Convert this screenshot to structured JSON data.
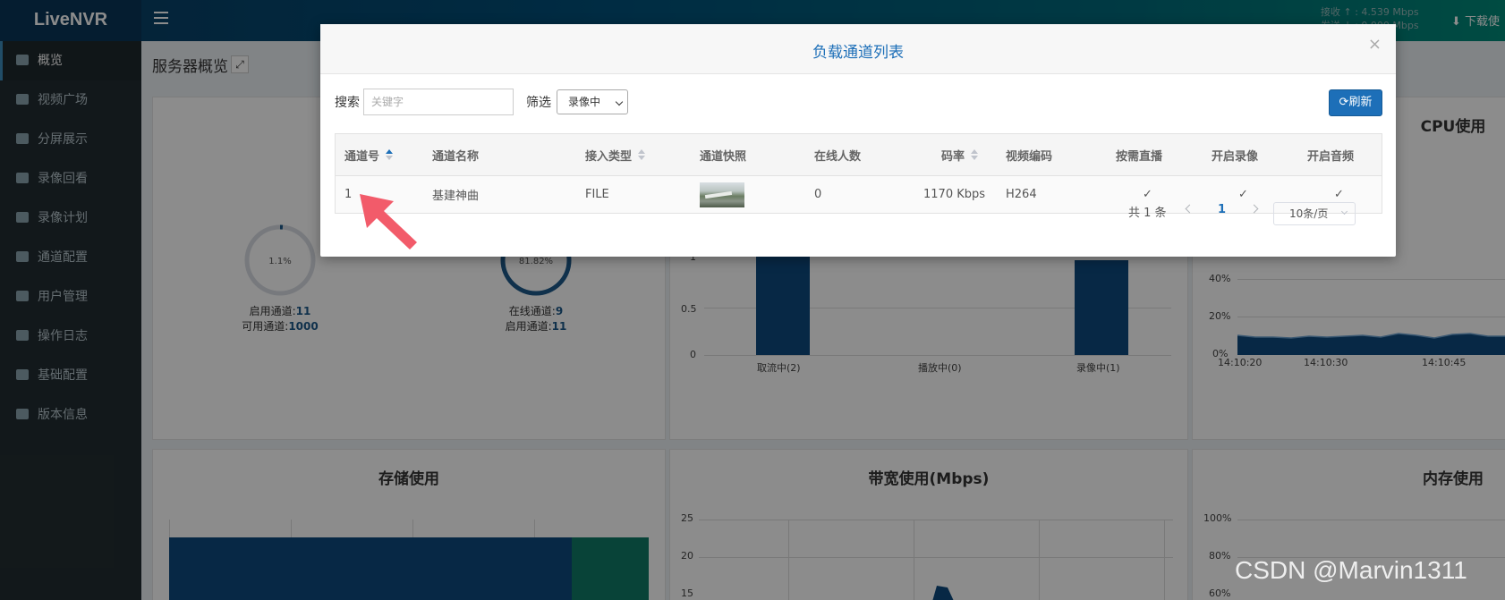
{
  "app": {
    "logo": "LiveNVR",
    "bandwidth_line1": "接收 ↑ : 4.539 Mbps",
    "bandwidth_line2": "发送 ↓ : 0.000 Mbps",
    "download_label": "下载使"
  },
  "sidebar": {
    "items": [
      {
        "label": "概览",
        "icon": "dashboard-icon"
      },
      {
        "label": "视频广场",
        "icon": "video-camera-icon"
      },
      {
        "label": "分屏展示",
        "icon": "grid-icon"
      },
      {
        "label": "录像回看",
        "icon": "backward-icon"
      },
      {
        "label": "录像计划",
        "icon": "calendar-icon"
      },
      {
        "label": "通道配置",
        "icon": "road-icon"
      },
      {
        "label": "用户管理",
        "icon": "users-icon"
      },
      {
        "label": "操作日志",
        "icon": "file-icon"
      },
      {
        "label": "基础配置",
        "icon": "gears-icon"
      },
      {
        "label": "版本信息",
        "icon": "info-icon"
      }
    ]
  },
  "overview": {
    "title": "服务器概览",
    "ring1_pct": "1.1%",
    "ring1_label1": "启用通道:",
    "ring1_value1": "11",
    "ring1_label2": "可用通道:",
    "ring1_value2": "1000",
    "ring2_pct": "81.82%",
    "ring2_label1": "在线通道:",
    "ring2_value1": "9",
    "ring2_label2": "启用通道:",
    "ring2_value2": "11",
    "cpu_title": "CPU使用",
    "storage_title": "存储使用",
    "bandwidth_title": "带宽使用(Mbps)",
    "memory_title": "内存使用",
    "status_chart": {
      "categories": [
        "取流中(2)",
        "播放中(0)",
        "录像中(1)"
      ],
      "y_ticks": [
        "1",
        "0.5",
        "0"
      ]
    },
    "cpu_chart": {
      "y_ticks": [
        "40%",
        "20%",
        "0%"
      ],
      "x_ticks": [
        "14:10:20",
        "14:10:30",
        "14:10:45"
      ]
    },
    "bw_chart": {
      "y_ticks": [
        "25",
        "20",
        "15"
      ]
    },
    "mem_chart": {
      "y_ticks": [
        "100%",
        "80%",
        "60%"
      ]
    }
  },
  "modal": {
    "title": "负载通道列表",
    "search_label": "搜索",
    "search_placeholder": "关键字",
    "filter_label": "筛选",
    "filter_value": "录像中",
    "refresh_label": "刷新",
    "columns": [
      "通道号",
      "通道名称",
      "接入类型",
      "通道快照",
      "在线人数",
      "码率",
      "视频编码",
      "按需直播",
      "开启录像",
      "开启音频"
    ],
    "rows": [
      {
        "id": "1",
        "name": "基建神曲",
        "type": "FILE",
        "online": "0",
        "bitrate": "1170 Kbps",
        "codec": "H264",
        "on_demand": "✓",
        "record": "✓",
        "audio": "✓"
      }
    ],
    "pager": {
      "total": "共 1 条",
      "current": "1",
      "page_size": "10条/页"
    }
  },
  "watermark": "CSDN @Marvin1311"
}
